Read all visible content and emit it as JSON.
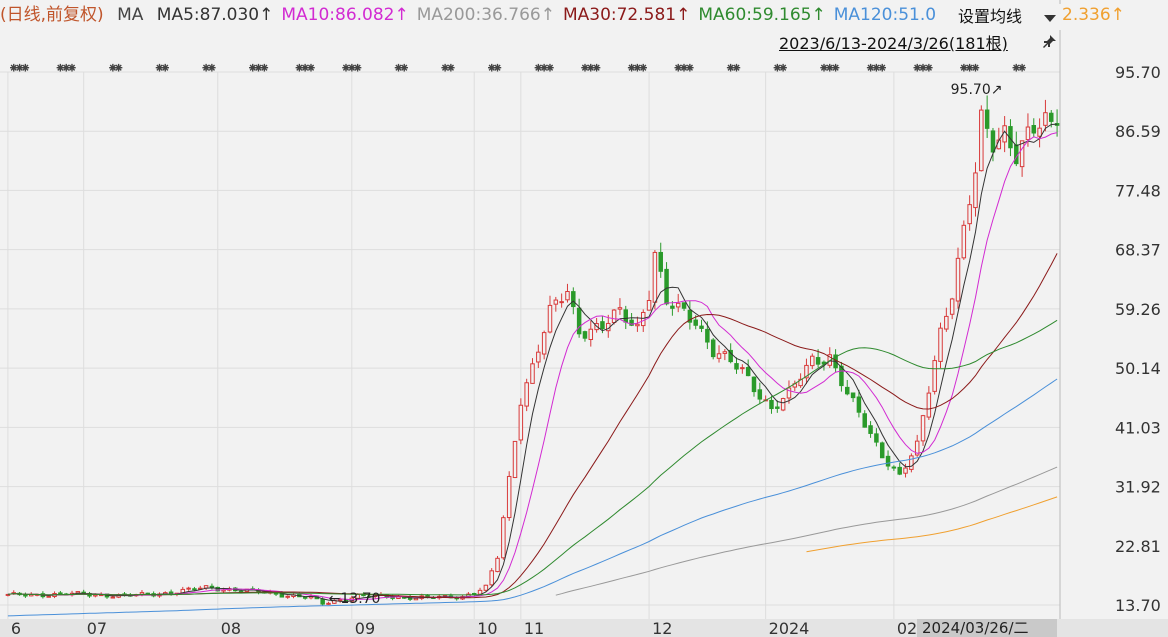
{
  "legend": {
    "prefix": "(日线,前复权)",
    "ma_label": "MA",
    "items": [
      {
        "text": "MA5:87.030↑",
        "color": "#333333"
      },
      {
        "text": "MA10:86.082↑",
        "color": "#d22bd2"
      },
      {
        "text": "MA200:36.766↑",
        "color": "#999999"
      },
      {
        "text": "MA30:72.581↑",
        "color": "#8b1a1a"
      },
      {
        "text": "MA60:59.165↑",
        "color": "#2f8a2f"
      },
      {
        "text": "MA120:51.0",
        "color": "#4a90d9"
      }
    ],
    "truncated_tail": "2.336↑",
    "truncated_color": "#f0a030"
  },
  "settings_button": "设置均线",
  "range_label": "2023/6/13-2024/3/26(181根)",
  "cursor_date": "2024/03/26/二",
  "chart_data": {
    "type": "candlestick",
    "y_axis": {
      "ticks": [
        "95.70",
        "86.59",
        "77.48",
        "68.37",
        "59.26",
        "50.14",
        "41.03",
        "31.92",
        "22.81",
        "13.70"
      ],
      "min": 13.7,
      "max": 95.7,
      "side": "right"
    },
    "x_axis": {
      "ticks": [
        {
          "label": "6",
          "i": 0
        },
        {
          "label": "07",
          "i": 13
        },
        {
          "label": "08",
          "i": 36
        },
        {
          "label": "09",
          "i": 59
        },
        {
          "label": "10",
          "i": 80
        },
        {
          "label": "11",
          "i": 88
        },
        {
          "label": "12",
          "i": 110
        },
        {
          "label": "2024",
          "i": 130
        },
        {
          "label": "02",
          "i": 152
        },
        {
          "label": "2024/03/26/二",
          "i": 180
        }
      ]
    },
    "annotations": [
      {
        "text": "95.70",
        "i": 172,
        "value": 95.7,
        "kind": "high"
      },
      {
        "text": "13.70",
        "i": 54,
        "value": 13.7,
        "kind": "low"
      }
    ],
    "anchors": [
      [
        0,
        15.2
      ],
      [
        12,
        15.4
      ],
      [
        20,
        15.1
      ],
      [
        28,
        15.6
      ],
      [
        34,
        16.4
      ],
      [
        42,
        15.8
      ],
      [
        52,
        14.8
      ],
      [
        54,
        13.9
      ],
      [
        60,
        15.1
      ],
      [
        72,
        14.8
      ],
      [
        78,
        15.0
      ],
      [
        82,
        16.4
      ],
      [
        84,
        21.0
      ],
      [
        86,
        33.0
      ],
      [
        88,
        45.5
      ],
      [
        90,
        50.5
      ],
      [
        93,
        58.5
      ],
      [
        96,
        62.0
      ],
      [
        98,
        56.0
      ],
      [
        102,
        56.5
      ],
      [
        105,
        58.5
      ],
      [
        108,
        56.5
      ],
      [
        110,
        62.0
      ],
      [
        111,
        68.0
      ],
      [
        113,
        60.0
      ],
      [
        118,
        57.5
      ],
      [
        121,
        53.0
      ],
      [
        126,
        49.5
      ],
      [
        131,
        44.0
      ],
      [
        134,
        46.0
      ],
      [
        138,
        51.5
      ],
      [
        141,
        52.0
      ],
      [
        144,
        46.0
      ],
      [
        147,
        41.5
      ],
      [
        150,
        37.0
      ],
      [
        153,
        33.5
      ],
      [
        156,
        38.0
      ],
      [
        158,
        47.0
      ],
      [
        160,
        56.0
      ],
      [
        162,
        62.0
      ],
      [
        164,
        71.0
      ],
      [
        166,
        80.0
      ],
      [
        167,
        88.0
      ],
      [
        169,
        85.0
      ],
      [
        171,
        87.0
      ],
      [
        173,
        83.0
      ],
      [
        175,
        85.5
      ],
      [
        178,
        88.0
      ],
      [
        180,
        87.5
      ]
    ],
    "moving_averages": [
      {
        "name": "MA5",
        "period": 5,
        "color": "#333333"
      },
      {
        "name": "MA10",
        "period": 10,
        "color": "#d22bd2"
      },
      {
        "name": "MA30",
        "period": 30,
        "color": "#8b1a1a"
      },
      {
        "name": "MA60",
        "period": 60,
        "color": "#2f8a2f"
      },
      {
        "name": "MA120",
        "period": 120,
        "color": "#4a90d9"
      },
      {
        "name": "MA200",
        "period": 200,
        "color": "#999999",
        "visible_from_i": 94
      },
      {
        "name": "MA250",
        "period": 250,
        "color": "#f0a030",
        "visible_from_i": 137
      }
    ],
    "up_color": "#d83a3a",
    "down_color": "#2a9a2a",
    "bar_count": 181,
    "last_close": 87.5,
    "grid": true
  }
}
